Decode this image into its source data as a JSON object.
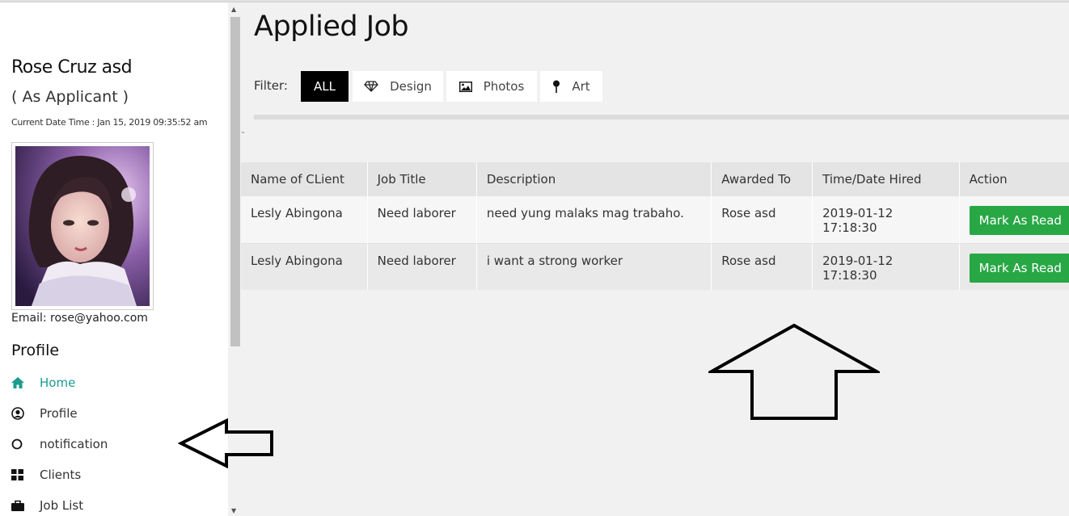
{
  "user": {
    "name": "Rose Cruz asd",
    "role": "( As Applicant )",
    "date_time": "Current Date Time : Jan 15, 2019 09:35:52 am",
    "email": "Email: rose@yahoo.com"
  },
  "sidebar": {
    "heading": "Profile",
    "items": [
      {
        "label": "Home",
        "icon": "home-icon"
      },
      {
        "label": "Profile",
        "icon": "user-circle-icon"
      },
      {
        "label": "notification",
        "icon": "circle-icon"
      },
      {
        "label": "Clients",
        "icon": "grid-icon"
      },
      {
        "label": "Job List",
        "icon": "briefcase-icon"
      }
    ]
  },
  "main": {
    "title": "Applied Job",
    "filter_label": "Filter:",
    "filters": [
      {
        "label": "ALL",
        "active": true
      },
      {
        "label": "Design",
        "icon": "diamond-icon"
      },
      {
        "label": "Photos",
        "icon": "image-icon"
      },
      {
        "label": "Art",
        "icon": "pin-icon"
      }
    ],
    "table": {
      "headers": [
        "Name of CLient",
        "Job Title",
        "Description",
        "Awarded To",
        "Time/Date Hired",
        "Action"
      ],
      "rows": [
        {
          "client": "Lesly Abingona",
          "job_title": "Need laborer",
          "description": "need yung malaks mag trabaho.",
          "awarded_to": "Rose asd",
          "hired": "2019-01-12 17:18:30",
          "action": "Mark As Read"
        },
        {
          "client": "Lesly Abingona",
          "job_title": "Need laborer",
          "description": "i want a strong worker",
          "awarded_to": "Rose asd",
          "hired": "2019-01-12 17:18:30",
          "action": "Mark As Read"
        }
      ]
    }
  },
  "colors": {
    "accent": "#1a9c8e",
    "action_button": "#28a745",
    "filter_active": "#000000"
  }
}
